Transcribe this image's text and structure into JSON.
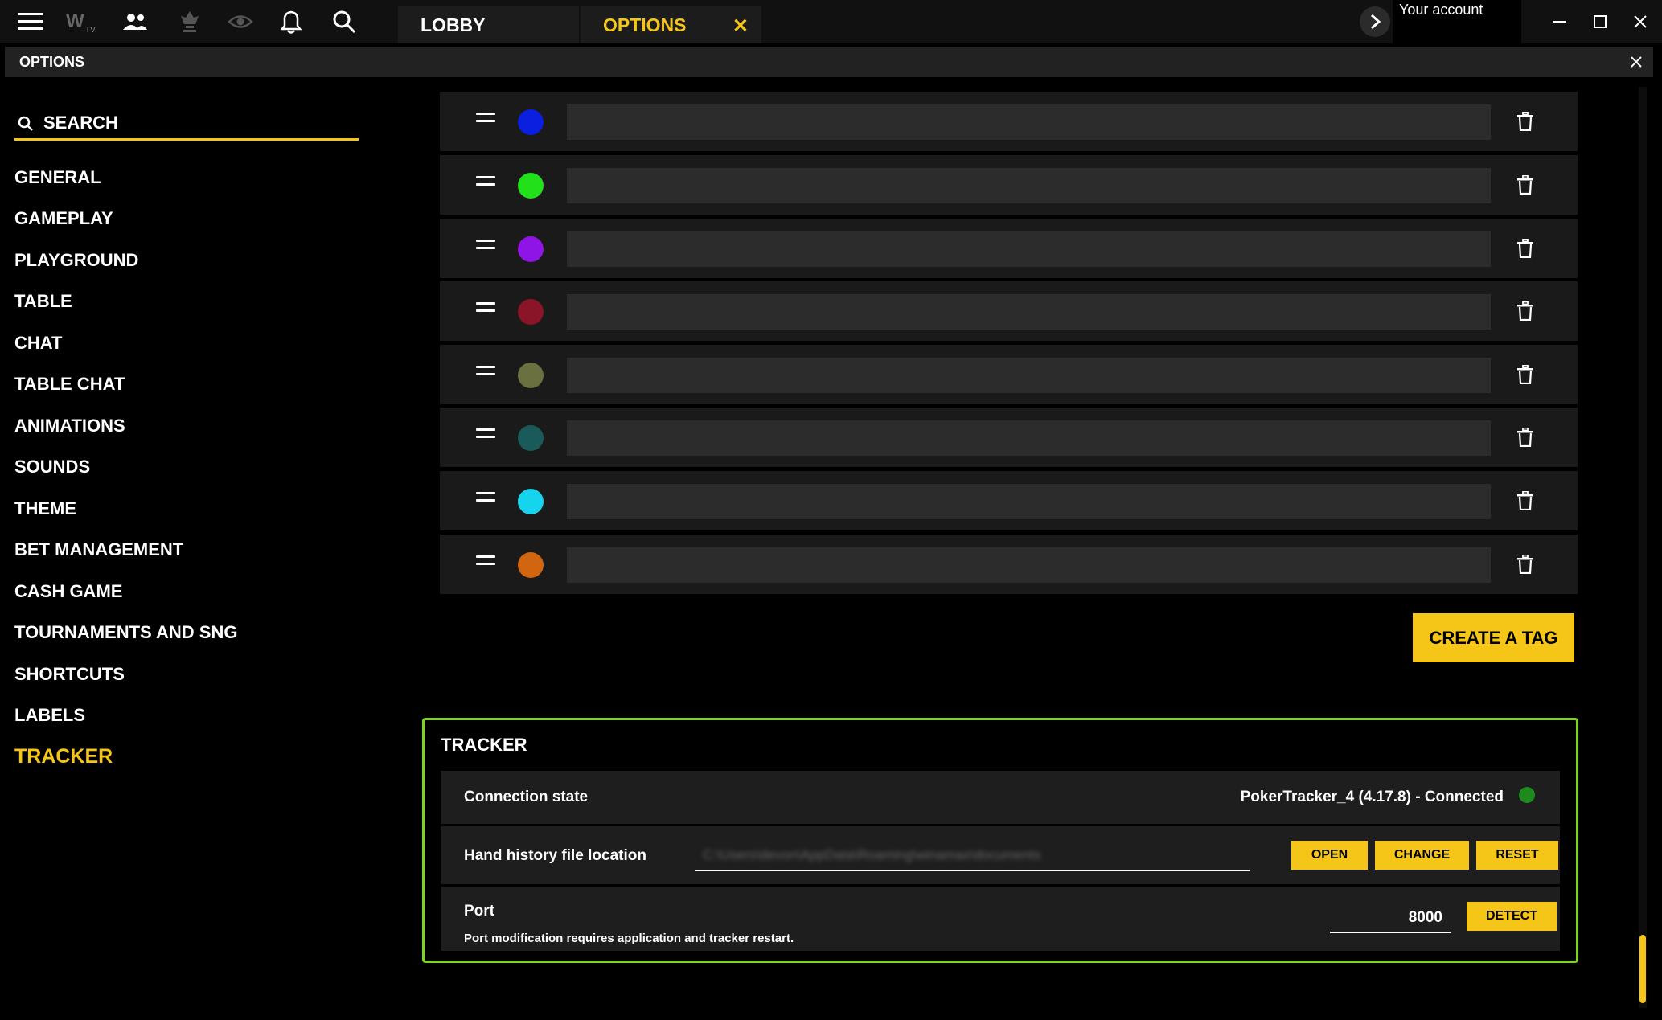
{
  "topbar": {
    "tabs": [
      {
        "label": "LOBBY"
      },
      {
        "label": "OPTIONS",
        "close": "✕"
      }
    ],
    "account_label": "Your account",
    "icons": [
      "menu-icon",
      "winamax-tv-icon",
      "friends-icon",
      "tournament-icon",
      "eye-icon",
      "bell-icon",
      "search-icon"
    ]
  },
  "panel": {
    "title": "OPTIONS"
  },
  "sidebar": {
    "search_label": "SEARCH",
    "items": [
      {
        "label": "GENERAL"
      },
      {
        "label": "GAMEPLAY"
      },
      {
        "label": "PLAYGROUND"
      },
      {
        "label": "TABLE"
      },
      {
        "label": "CHAT"
      },
      {
        "label": "TABLE CHAT"
      },
      {
        "label": "ANIMATIONS"
      },
      {
        "label": "SOUNDS"
      },
      {
        "label": "THEME"
      },
      {
        "label": "BET MANAGEMENT"
      },
      {
        "label": "CASH GAME"
      },
      {
        "label": "TOURNAMENTS AND SNG"
      },
      {
        "label": "SHORTCUTS"
      },
      {
        "label": "LABELS"
      },
      {
        "label": "TRACKER"
      }
    ],
    "active": "TRACKER"
  },
  "tags": [
    {
      "color": "#0a1fe0"
    },
    {
      "color": "#22e01a"
    },
    {
      "color": "#8f14e6"
    },
    {
      "color": "#8a1428"
    },
    {
      "color": "#6b7040"
    },
    {
      "color": "#1a5a5a"
    },
    {
      "color": "#16d4ee"
    },
    {
      "color": "#d2650f"
    }
  ],
  "create_tag_label": "CREATE A TAG",
  "tracker": {
    "title": "TRACKER",
    "connection_label": "Connection state",
    "connection_value": "PokerTracker_4 (4.17.8) - Connected",
    "connection_color": "#1e8a1e",
    "hand_history_label": "Hand history file location",
    "hand_history_value": "C:\\Users\\devon\\AppData\\Roaming\\winamax\\documents",
    "open_label": "OPEN",
    "change_label": "CHANGE",
    "reset_label": "RESET",
    "port_label": "Port",
    "port_value": "8000",
    "port_note": "Port modification requires application and tracker restart.",
    "detect_label": "DETECT"
  },
  "colors": {
    "accent": "#f5c518",
    "tracker_border": "#7ed321"
  }
}
